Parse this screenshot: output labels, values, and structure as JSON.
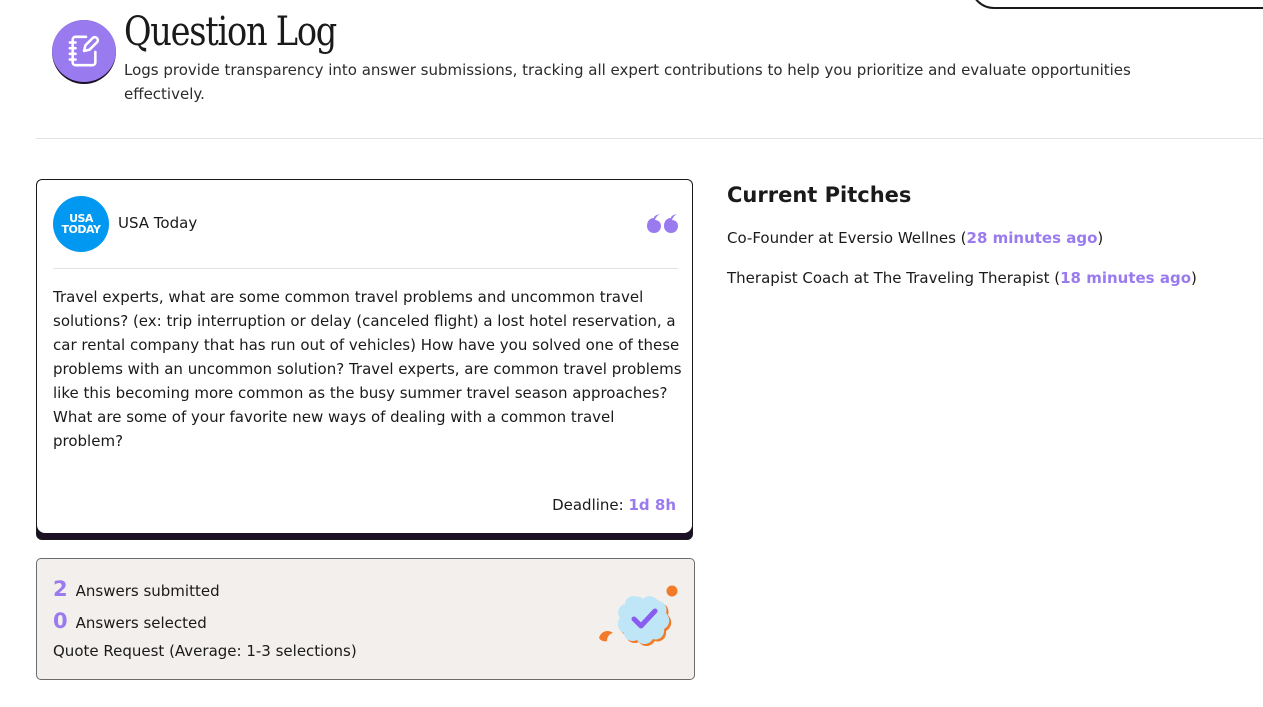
{
  "header": {
    "title": "Question Log",
    "subtitle": "Logs provide transparency into answer submissions, tracking all expert contributions to help you prioritize and evaluate opportunities effectively.",
    "icon": "notebook-pen-icon"
  },
  "question": {
    "outlet": {
      "name": "USA Today",
      "logo_line1": "USA",
      "logo_line2": "TODAY",
      "logo_color": "#0098f0"
    },
    "text": "Travel experts, what are some common travel problems and uncommon travel solutions? (ex: trip interruption or delay (canceled flight) a lost hotel reservation, a car rental company that has run out of vehicles) How have you solved one of these problems with an uncommon solution? Travel experts, are common travel problems like this becoming more common as the busy summer travel season approaches? What are some of your favorite new ways of dealing with a common travel problem?",
    "deadline_label": "Deadline:",
    "deadline_value": "1d 8h"
  },
  "stats": {
    "submitted_count": "2",
    "submitted_label": "Answers submitted",
    "selected_count": "0",
    "selected_label": "Answers selected",
    "quote_request": "Quote Request (Average: 1-3 selections)"
  },
  "pitches": {
    "title": "Current Pitches",
    "items": [
      {
        "role": "Co-Founder at Eversio Wellnes",
        "time": "28 minutes ago"
      },
      {
        "role": "Therapist Coach at The Traveling Therapist",
        "time": "18 minutes ago"
      }
    ]
  },
  "colors": {
    "accent": "#9a7bef",
    "dark": "#1c1026",
    "stats_bg": "#f3efec"
  }
}
